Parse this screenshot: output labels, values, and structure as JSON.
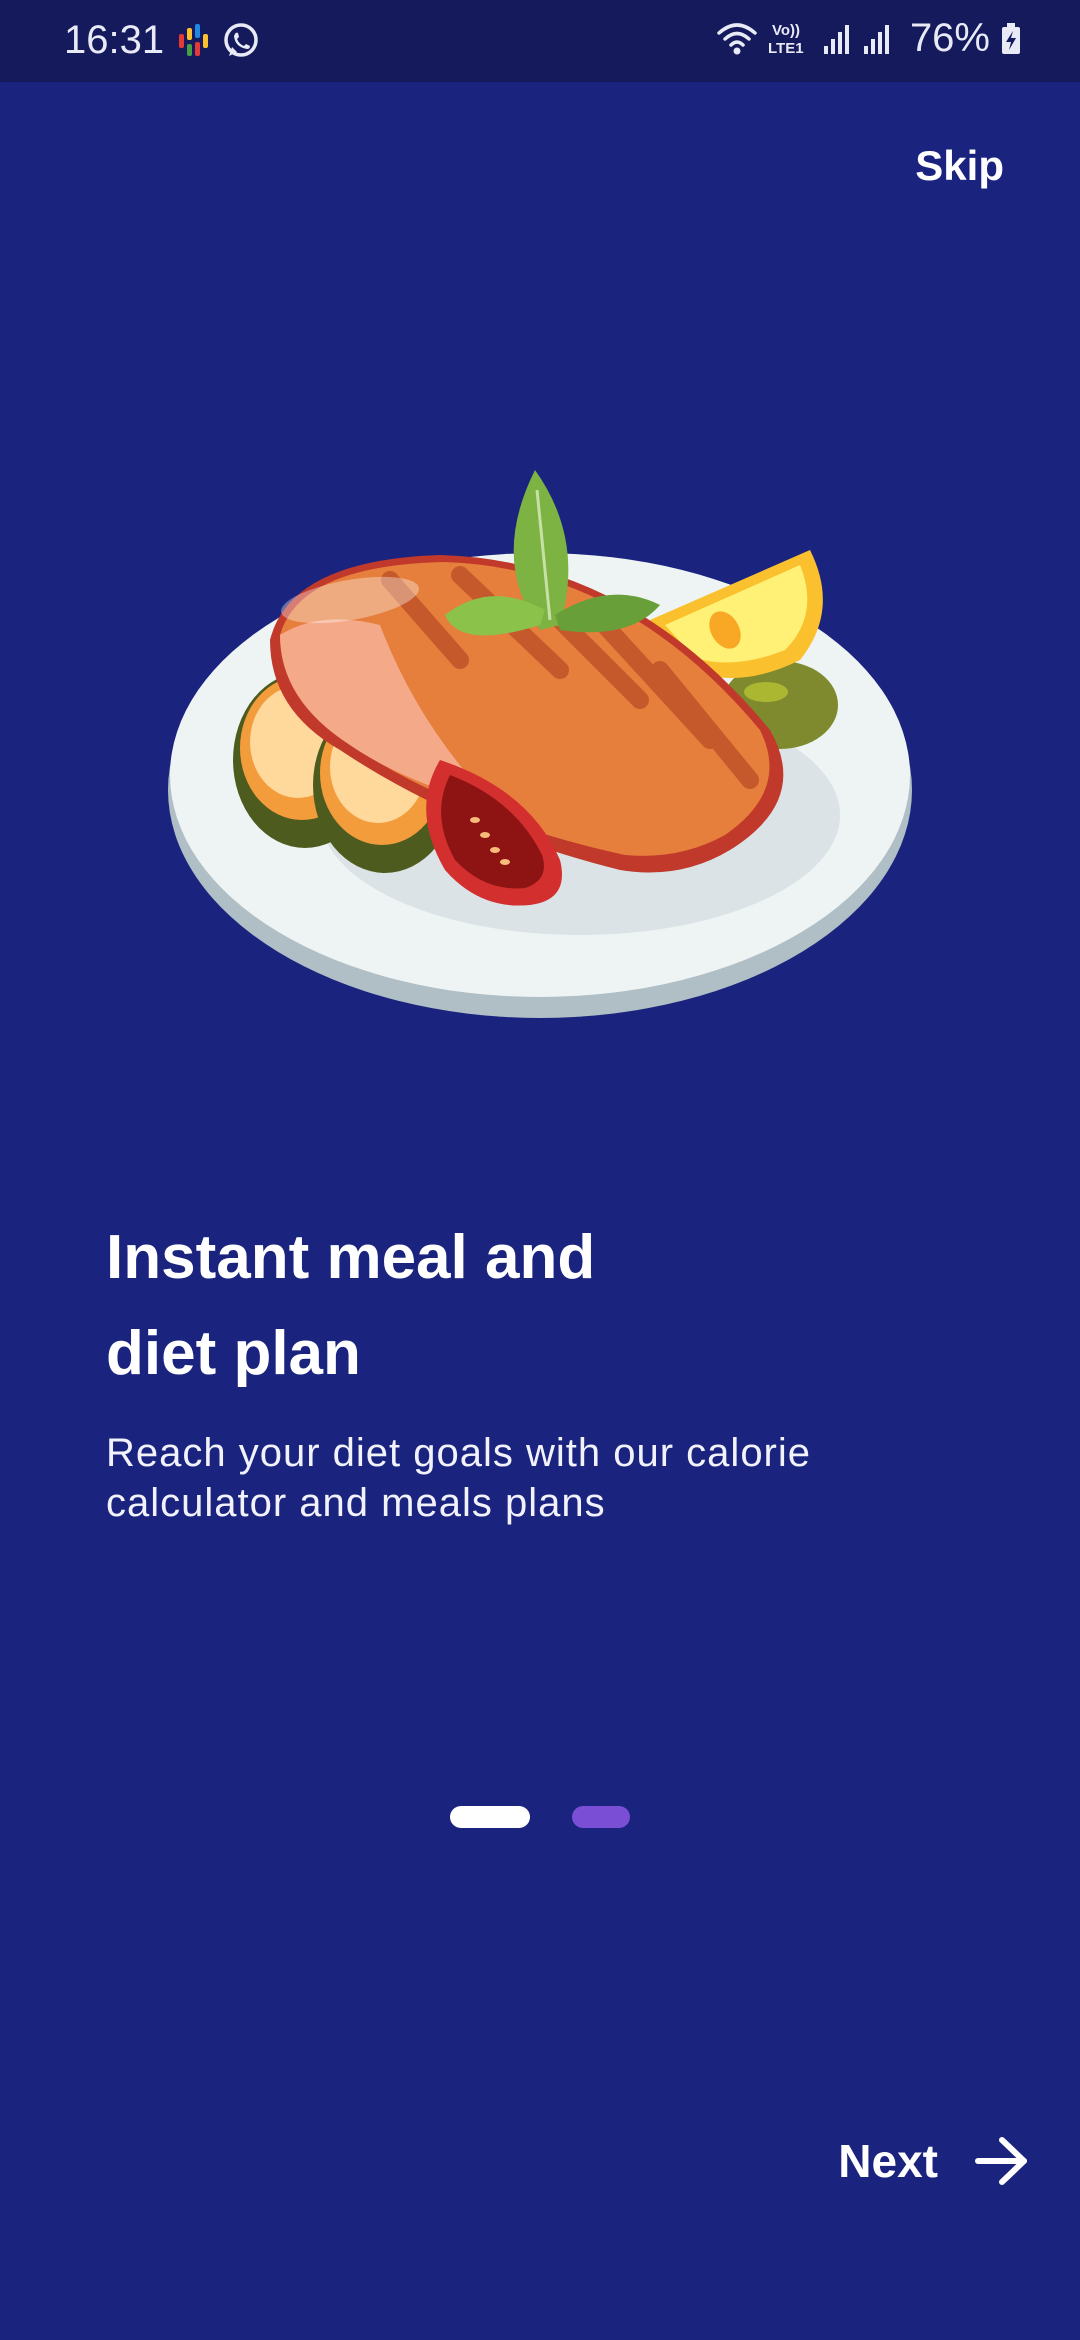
{
  "status_bar": {
    "time": "16:31",
    "battery_percent": "76%",
    "network_label": "Vo)) LTE1",
    "icons": [
      "podcasts-icon",
      "whatsapp-icon",
      "wifi-icon",
      "volte-icon",
      "signal-icon",
      "signal-icon",
      "battery-charging-icon"
    ]
  },
  "header": {
    "skip_label": "Skip"
  },
  "onboarding": {
    "title_line1": "Instant meal and",
    "title_line2": "diet plan",
    "subtitle_line1": "Reach your diet goals with our calorie",
    "subtitle_line2": "calculator and meals plans",
    "page_index": 1,
    "page_count": 2,
    "illustration": "grilled-salmon-plate-illustration"
  },
  "footer": {
    "next_label": "Next",
    "next_icon": "arrow-right-icon"
  },
  "colors": {
    "background": "#1a237e",
    "status_bar": "#141a5c",
    "dot_active": "#ffffff",
    "dot_inactive": "#7a4fd6"
  }
}
